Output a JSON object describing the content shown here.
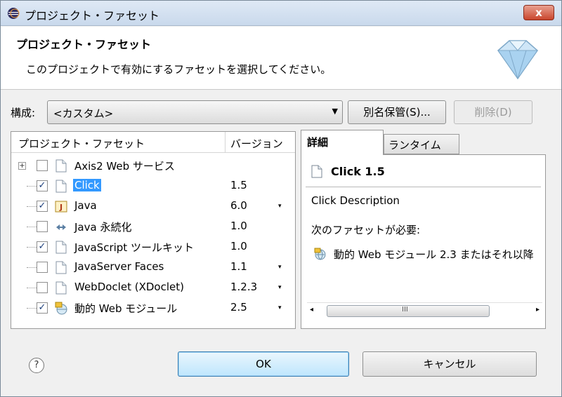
{
  "window": {
    "title": "プロジェクト・ファセット",
    "close_label": "x"
  },
  "banner": {
    "title": "プロジェクト・ファセット",
    "description": "このプロジェクトで有効にするファセットを選択してください。"
  },
  "config": {
    "label": "構成:",
    "selected": "<カスタム>",
    "save_as_label": "別名保管(S)...",
    "delete_label": "削除(D)"
  },
  "facets": {
    "header_name": "プロジェクト・ファセット",
    "header_version": "バージョン",
    "rows": [
      {
        "name": "Axis2 Web サービス",
        "version": "",
        "checked": false,
        "has_dropdown": false,
        "expander": "+"
      },
      {
        "name": "Click",
        "version": "1.5",
        "checked": true,
        "has_dropdown": false,
        "selected": true
      },
      {
        "name": "Java",
        "version": "6.0",
        "checked": true,
        "has_dropdown": true
      },
      {
        "name": "Java 永続化",
        "version": "1.0",
        "checked": false,
        "has_dropdown": false
      },
      {
        "name": "JavaScript ツールキット",
        "version": "1.0",
        "checked": true,
        "has_dropdown": false
      },
      {
        "name": "JavaServer Faces",
        "version": "1.1",
        "checked": false,
        "has_dropdown": true
      },
      {
        "name": "WebDoclet (XDoclet)",
        "version": "1.2.3",
        "checked": false,
        "has_dropdown": true
      },
      {
        "name": "動的 Web モジュール",
        "version": "2.5",
        "checked": true,
        "has_dropdown": true
      }
    ],
    "check_mark": "✓",
    "dropdown_glyph": "▾"
  },
  "tabs": {
    "details": "詳細",
    "runtime": "ランタイム"
  },
  "details": {
    "title": "Click 1.5",
    "description": "Click Description",
    "requires_label": "次のファセットが必要:",
    "dependency": "動的 Web モジュール 2.3 またはそれ以降"
  },
  "scrollbar": {
    "left": "◂",
    "right": "▸",
    "grip": "III"
  },
  "buttons": {
    "help": "?",
    "ok": "OK",
    "cancel": "キャンセル"
  }
}
